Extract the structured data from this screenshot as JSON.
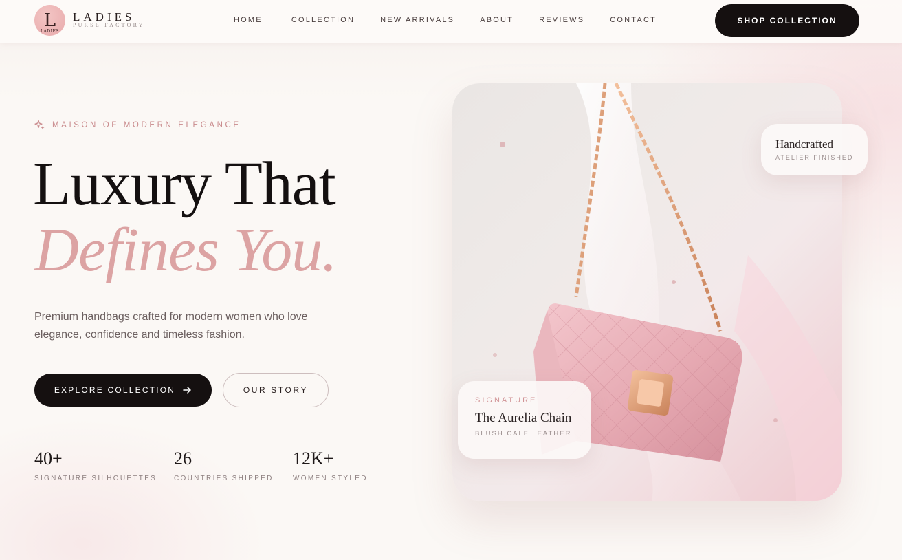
{
  "brand": {
    "logo_initial": "L",
    "logo_badge": "LADIES",
    "name": "LADIES",
    "tagline": "PURSE FACTORY"
  },
  "nav": {
    "items": [
      {
        "label": "HOME"
      },
      {
        "label": "COLLECTION"
      },
      {
        "label": "NEW ARRIVALS"
      },
      {
        "label": "ABOUT"
      },
      {
        "label": "REVIEWS"
      },
      {
        "label": "CONTACT"
      }
    ],
    "cta_label": "SHOP COLLECTION"
  },
  "hero": {
    "eyebrow": "MAISON OF MODERN ELEGANCE",
    "title_line1": "Luxury That",
    "title_line2": "Defines You.",
    "description": "Premium handbags crafted for modern women who love elegance, confidence and timeless fashion.",
    "primary_button": "EXPLORE COLLECTION",
    "secondary_button": "OUR STORY",
    "stats": [
      {
        "value": "40+",
        "label": "SIGNATURE SILHOUETTES"
      },
      {
        "value": "26",
        "label": "COUNTRIES SHIPPED"
      },
      {
        "value": "12K+",
        "label": "WOMEN STYLED"
      }
    ]
  },
  "product": {
    "badge_top_title": "Handcrafted",
    "badge_top_subtitle": "ATELIER FINISHED",
    "badge_label": "SIGNATURE",
    "badge_name": "The Aurelia Chain",
    "badge_material": "BLUSH CALF LEATHER"
  },
  "colors": {
    "accent_pink": "#dca3a3",
    "dark": "#151010",
    "background": "#fbf8f5",
    "chain_gold": "#d7926a"
  },
  "icons": {
    "eyebrow": "sparkle-icon",
    "primary_button": "arrow-right-icon"
  }
}
